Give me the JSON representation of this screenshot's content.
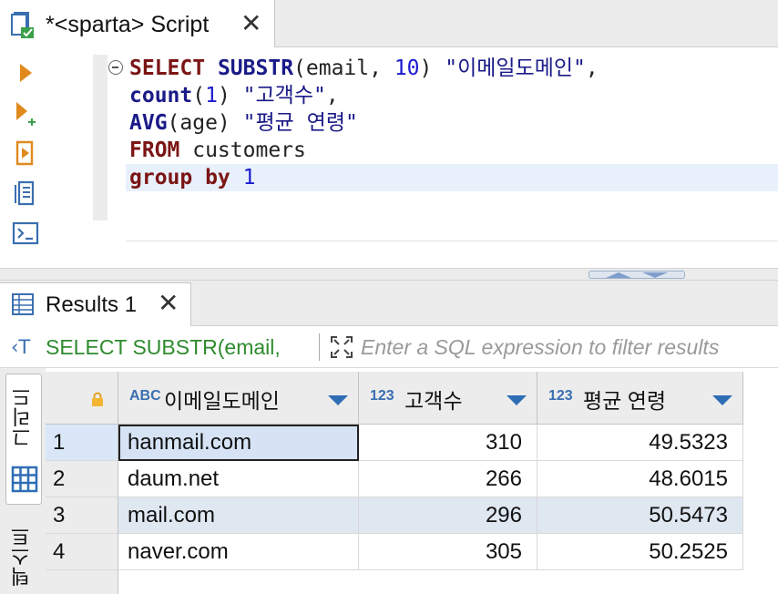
{
  "editor_tab": {
    "title": "*<sparta> Script",
    "close_glyph": "✕"
  },
  "toolbar": {
    "tools": [
      {
        "name": "execute-statement-icon"
      },
      {
        "name": "execute-in-new-tab-icon"
      },
      {
        "name": "execute-script-icon"
      },
      {
        "name": "explain-plan-icon"
      },
      {
        "name": "console-icon"
      }
    ]
  },
  "sql": {
    "lines": [
      [
        {
          "t": "SELECT",
          "c": "kw"
        },
        {
          "t": " ",
          "c": "plain"
        },
        {
          "t": "SUBSTR",
          "c": "fn"
        },
        {
          "t": "(email, ",
          "c": "plain"
        },
        {
          "t": "10",
          "c": "num"
        },
        {
          "t": ") ",
          "c": "plain"
        },
        {
          "t": "\"이메일도메인\"",
          "c": "str"
        },
        {
          "t": ",",
          "c": "plain"
        }
      ],
      [
        {
          "t": "count",
          "c": "fn"
        },
        {
          "t": "(",
          "c": "plain"
        },
        {
          "t": "1",
          "c": "num"
        },
        {
          "t": ") ",
          "c": "plain"
        },
        {
          "t": "\"고객수\"",
          "c": "str"
        },
        {
          "t": ",",
          "c": "plain"
        }
      ],
      [
        {
          "t": "AVG",
          "c": "fn"
        },
        {
          "t": "(age) ",
          "c": "plain"
        },
        {
          "t": "\"평균 연령\"",
          "c": "str"
        }
      ],
      [
        {
          "t": "FROM",
          "c": "kw"
        },
        {
          "t": " customers",
          "c": "plain"
        }
      ],
      [
        {
          "t": "group by",
          "c": "kw"
        },
        {
          "t": " ",
          "c": "plain"
        },
        {
          "t": "1",
          "c": "num"
        }
      ]
    ]
  },
  "results_tab": {
    "title": "Results 1",
    "close_glyph": "✕"
  },
  "filter": {
    "query_icon": "‹T",
    "query_text": "SELECT SUBSTR(email,",
    "placeholder": "Enter a SQL expression to filter results"
  },
  "side_tabs": {
    "grid_label": "그리드",
    "text_label": "텍스트"
  },
  "grid": {
    "columns": [
      {
        "type": "ABC",
        "label": "이메일도메인"
      },
      {
        "type": "123",
        "label": "고객수"
      },
      {
        "type": "123",
        "label": "평균 연령"
      }
    ],
    "rows": [
      {
        "num": "1",
        "domain": "hanmail.com",
        "count": "310",
        "avg": "49.5323"
      },
      {
        "num": "2",
        "domain": "daum.net",
        "count": "266",
        "avg": "48.6015"
      },
      {
        "num": "3",
        "domain": "mail.com",
        "count": "296",
        "avg": "50.5473"
      },
      {
        "num": "4",
        "domain": "naver.com",
        "count": "305",
        "avg": "50.2525"
      }
    ]
  },
  "colors": {
    "keyword": "#7b1515",
    "function": "#1a1a88",
    "number": "#1a1ad0",
    "filter_text": "#2e8b2e",
    "accent": "#2f6db5",
    "stripe": "#dfe7f1"
  }
}
